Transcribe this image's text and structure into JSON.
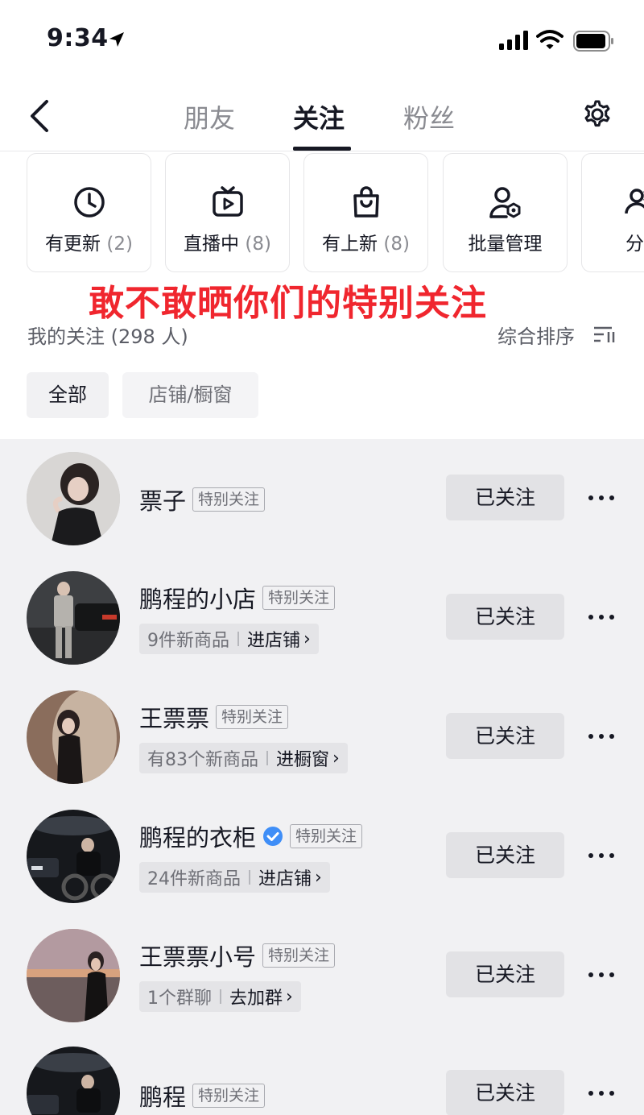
{
  "status_bar": {
    "time": "9:34"
  },
  "nav": {
    "tabs": [
      {
        "label": "朋友"
      },
      {
        "label": "关注"
      },
      {
        "label": "粉丝"
      }
    ],
    "active_tab": "关注"
  },
  "quick_cards": [
    {
      "label": "有更新",
      "count": "(2)",
      "icon": "clock-icon"
    },
    {
      "label": "直播中",
      "count": "(8)",
      "icon": "tv-icon"
    },
    {
      "label": "有上新",
      "count": "(8)",
      "icon": "shopping-bag-icon"
    },
    {
      "label": "批量管理",
      "count": "",
      "icon": "user-settings-icon"
    },
    {
      "label": "分",
      "count": "",
      "icon": "group-icon"
    }
  ],
  "overlay_title": "敢不敢晒你们的特别关注",
  "summary": {
    "label": "我的关注 (298 人)",
    "sort_label": "综合排序"
  },
  "filters": [
    {
      "label": "全部"
    },
    {
      "label": "店铺/橱窗"
    }
  ],
  "follow_list": [
    {
      "name": "票子",
      "badge": "特别关注",
      "verified": false,
      "sub_info": "",
      "sub_action": "",
      "button": "已关注"
    },
    {
      "name": "鹏程的小店",
      "badge": "特别关注",
      "verified": false,
      "sub_info": "9件新商品",
      "sub_action": "进店铺",
      "button": "已关注"
    },
    {
      "name": "王票票",
      "badge": "特别关注",
      "verified": false,
      "sub_info": "有83个新商品",
      "sub_action": "进橱窗",
      "button": "已关注"
    },
    {
      "name": "鹏程的衣柜",
      "badge": "特别关注",
      "verified": true,
      "sub_info": "24件新商品",
      "sub_action": "进店铺",
      "button": "已关注"
    },
    {
      "name": "王票票小号",
      "badge": "特别关注",
      "verified": false,
      "sub_info": "1个群聊",
      "sub_action": "去加群",
      "button": "已关注"
    },
    {
      "name": "鹏程",
      "badge": "特别关注",
      "verified": false,
      "sub_info": "",
      "sub_action": "",
      "button": "已关注"
    }
  ],
  "colors": {
    "accent_red": "#f0262e",
    "verified_blue": "#3f8ef7",
    "list_bg": "#f1f1f3"
  }
}
